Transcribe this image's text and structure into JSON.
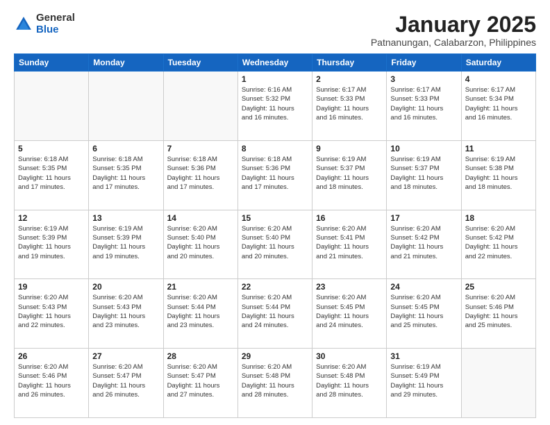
{
  "logo": {
    "general": "General",
    "blue": "Blue"
  },
  "title": "January 2025",
  "subtitle": "Patnanungan, Calabarzon, Philippines",
  "days_of_week": [
    "Sunday",
    "Monday",
    "Tuesday",
    "Wednesday",
    "Thursday",
    "Friday",
    "Saturday"
  ],
  "weeks": [
    [
      {
        "day": "",
        "info": ""
      },
      {
        "day": "",
        "info": ""
      },
      {
        "day": "",
        "info": ""
      },
      {
        "day": "1",
        "info": "Sunrise: 6:16 AM\nSunset: 5:32 PM\nDaylight: 11 hours\nand 16 minutes."
      },
      {
        "day": "2",
        "info": "Sunrise: 6:17 AM\nSunset: 5:33 PM\nDaylight: 11 hours\nand 16 minutes."
      },
      {
        "day": "3",
        "info": "Sunrise: 6:17 AM\nSunset: 5:33 PM\nDaylight: 11 hours\nand 16 minutes."
      },
      {
        "day": "4",
        "info": "Sunrise: 6:17 AM\nSunset: 5:34 PM\nDaylight: 11 hours\nand 16 minutes."
      }
    ],
    [
      {
        "day": "5",
        "info": "Sunrise: 6:18 AM\nSunset: 5:35 PM\nDaylight: 11 hours\nand 17 minutes."
      },
      {
        "day": "6",
        "info": "Sunrise: 6:18 AM\nSunset: 5:35 PM\nDaylight: 11 hours\nand 17 minutes."
      },
      {
        "day": "7",
        "info": "Sunrise: 6:18 AM\nSunset: 5:36 PM\nDaylight: 11 hours\nand 17 minutes."
      },
      {
        "day": "8",
        "info": "Sunrise: 6:18 AM\nSunset: 5:36 PM\nDaylight: 11 hours\nand 17 minutes."
      },
      {
        "day": "9",
        "info": "Sunrise: 6:19 AM\nSunset: 5:37 PM\nDaylight: 11 hours\nand 18 minutes."
      },
      {
        "day": "10",
        "info": "Sunrise: 6:19 AM\nSunset: 5:37 PM\nDaylight: 11 hours\nand 18 minutes."
      },
      {
        "day": "11",
        "info": "Sunrise: 6:19 AM\nSunset: 5:38 PM\nDaylight: 11 hours\nand 18 minutes."
      }
    ],
    [
      {
        "day": "12",
        "info": "Sunrise: 6:19 AM\nSunset: 5:39 PM\nDaylight: 11 hours\nand 19 minutes."
      },
      {
        "day": "13",
        "info": "Sunrise: 6:19 AM\nSunset: 5:39 PM\nDaylight: 11 hours\nand 19 minutes."
      },
      {
        "day": "14",
        "info": "Sunrise: 6:20 AM\nSunset: 5:40 PM\nDaylight: 11 hours\nand 20 minutes."
      },
      {
        "day": "15",
        "info": "Sunrise: 6:20 AM\nSunset: 5:40 PM\nDaylight: 11 hours\nand 20 minutes."
      },
      {
        "day": "16",
        "info": "Sunrise: 6:20 AM\nSunset: 5:41 PM\nDaylight: 11 hours\nand 21 minutes."
      },
      {
        "day": "17",
        "info": "Sunrise: 6:20 AM\nSunset: 5:42 PM\nDaylight: 11 hours\nand 21 minutes."
      },
      {
        "day": "18",
        "info": "Sunrise: 6:20 AM\nSunset: 5:42 PM\nDaylight: 11 hours\nand 22 minutes."
      }
    ],
    [
      {
        "day": "19",
        "info": "Sunrise: 6:20 AM\nSunset: 5:43 PM\nDaylight: 11 hours\nand 22 minutes."
      },
      {
        "day": "20",
        "info": "Sunrise: 6:20 AM\nSunset: 5:43 PM\nDaylight: 11 hours\nand 23 minutes."
      },
      {
        "day": "21",
        "info": "Sunrise: 6:20 AM\nSunset: 5:44 PM\nDaylight: 11 hours\nand 23 minutes."
      },
      {
        "day": "22",
        "info": "Sunrise: 6:20 AM\nSunset: 5:44 PM\nDaylight: 11 hours\nand 24 minutes."
      },
      {
        "day": "23",
        "info": "Sunrise: 6:20 AM\nSunset: 5:45 PM\nDaylight: 11 hours\nand 24 minutes."
      },
      {
        "day": "24",
        "info": "Sunrise: 6:20 AM\nSunset: 5:45 PM\nDaylight: 11 hours\nand 25 minutes."
      },
      {
        "day": "25",
        "info": "Sunrise: 6:20 AM\nSunset: 5:46 PM\nDaylight: 11 hours\nand 25 minutes."
      }
    ],
    [
      {
        "day": "26",
        "info": "Sunrise: 6:20 AM\nSunset: 5:46 PM\nDaylight: 11 hours\nand 26 minutes."
      },
      {
        "day": "27",
        "info": "Sunrise: 6:20 AM\nSunset: 5:47 PM\nDaylight: 11 hours\nand 26 minutes."
      },
      {
        "day": "28",
        "info": "Sunrise: 6:20 AM\nSunset: 5:47 PM\nDaylight: 11 hours\nand 27 minutes."
      },
      {
        "day": "29",
        "info": "Sunrise: 6:20 AM\nSunset: 5:48 PM\nDaylight: 11 hours\nand 28 minutes."
      },
      {
        "day": "30",
        "info": "Sunrise: 6:20 AM\nSunset: 5:48 PM\nDaylight: 11 hours\nand 28 minutes."
      },
      {
        "day": "31",
        "info": "Sunrise: 6:19 AM\nSunset: 5:49 PM\nDaylight: 11 hours\nand 29 minutes."
      },
      {
        "day": "",
        "info": ""
      }
    ]
  ]
}
